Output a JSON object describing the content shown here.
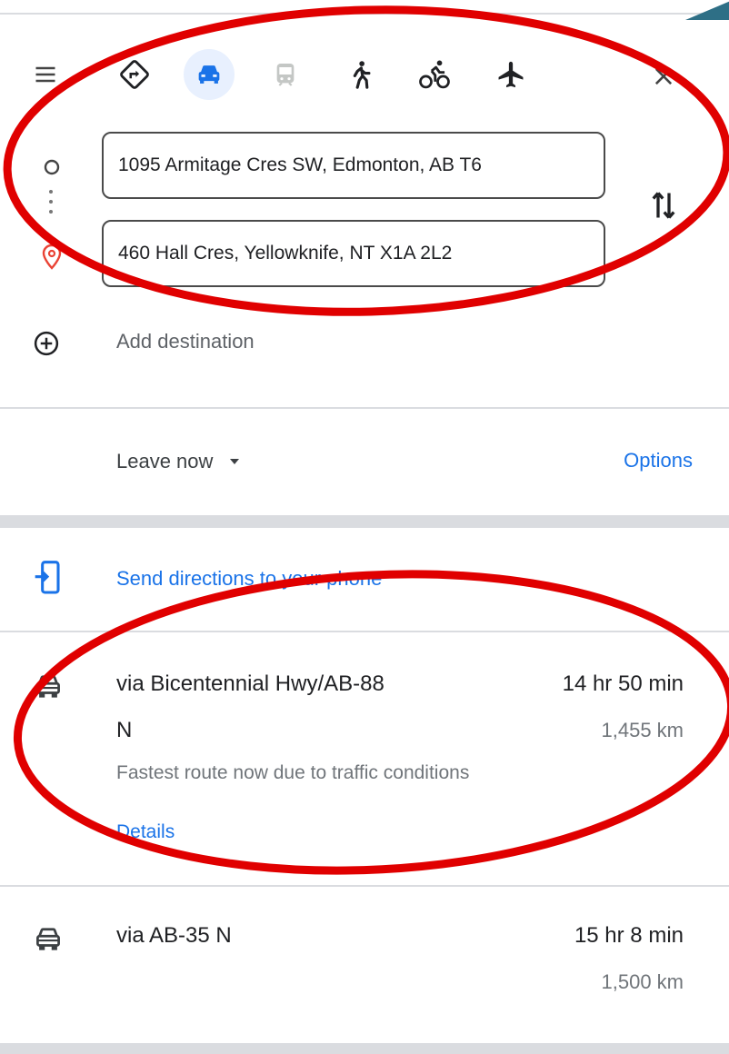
{
  "travel_modes": [
    {
      "name": "best",
      "icon": "directions-icon",
      "active": false
    },
    {
      "name": "driving",
      "icon": "car-icon",
      "active": true
    },
    {
      "name": "transit",
      "icon": "train-icon",
      "active": false
    },
    {
      "name": "walking",
      "icon": "walk-icon",
      "active": false
    },
    {
      "name": "cycling",
      "icon": "bike-icon",
      "active": false
    },
    {
      "name": "flights",
      "icon": "plane-icon",
      "active": false
    }
  ],
  "origin": {
    "value": "1095 Armitage Cres SW, Edmonton, AB T6"
  },
  "destination": {
    "value": "460 Hall Cres, Yellowknife, NT X1A 2L2"
  },
  "add_destination": "Add destination",
  "leave_now": "Leave now",
  "options": "Options",
  "send_to_phone": "Send directions to your phone",
  "routes": [
    {
      "name_line1": "via Bicentennial Hwy/AB-88",
      "name_line2": "N",
      "time": "14 hr 50 min",
      "distance": "1,455 km",
      "note": "Fastest route now due to traffic conditions",
      "details": "Details"
    },
    {
      "name_line1": "via AB-35 N",
      "time": "15 hr 8 min",
      "distance": "1,500 km"
    }
  ],
  "colors": {
    "accent": "#1a73e8",
    "annotation": "#e00000",
    "active_mode_bg": "#e8f0fe",
    "destination_pin": "#ea4335"
  }
}
